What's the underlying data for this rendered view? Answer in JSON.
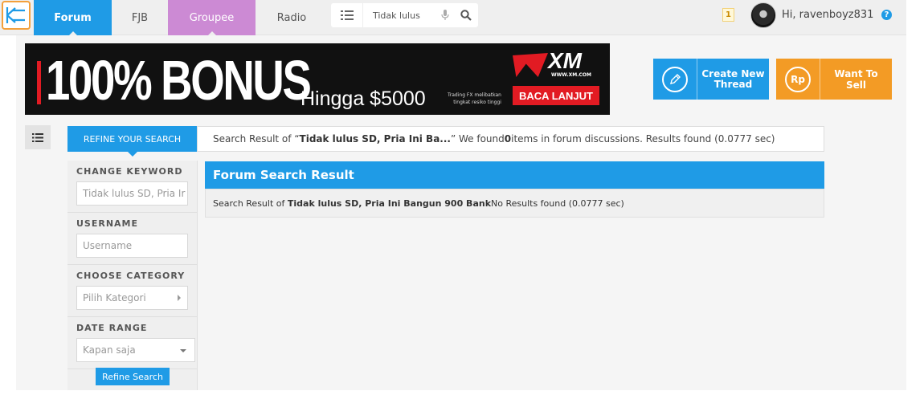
{
  "nav": {
    "logo_icon": "kaskus-logo-icon",
    "items": [
      {
        "label": "Forum"
      },
      {
        "label": "FJB"
      },
      {
        "label": "Groupee"
      },
      {
        "label": "Radio"
      }
    ],
    "search": {
      "value": "Tidak lulus"
    },
    "notification_count": "1",
    "greeting": "Hi, ravenboyz831",
    "help": "?"
  },
  "banner": {
    "headline": "100% BONUS",
    "subline": "Hingga $5000",
    "disclaimer_1": "Trading FX melibatkan",
    "disclaimer_2": "tingkat resiko tinggi",
    "brand": "XM",
    "brand_url": "WWW.XM.COM",
    "cta": "BACA LANJUT"
  },
  "actions": {
    "create_thread": "Create New Thread",
    "want_to_sell": "Want To Sell",
    "rp_symbol": "Rp"
  },
  "refine": {
    "tab_label": "REFINE YOUR SEARCH",
    "sections": {
      "keyword": {
        "title": "CHANGE KEYWORD",
        "value": "Tidak lulus SD, Pria Ir"
      },
      "username": {
        "title": "USERNAME",
        "placeholder": "Username"
      },
      "category": {
        "title": "CHOOSE CATEGORY",
        "value": "Pilih Kategori"
      },
      "date": {
        "title": "DATE RANGE",
        "value": "Kapan saja"
      }
    },
    "button": "Refine Search"
  },
  "result_bar": {
    "prefix": "Search Result of “",
    "query": "Tidak lulus SD, Pria Ini Ba...",
    "mid": "” We found ",
    "count": "0",
    "suffix": " items in forum discussions. Results found (0.0777 sec)"
  },
  "forum_result": {
    "title": "Forum Search Result",
    "prefix": "Search Result of ",
    "query": "Tidak lulus SD, Pria Ini Bangun 900 Bank",
    "suffix": " No Results found (0.0777 sec)"
  },
  "colors": {
    "primary": "#1f9be6",
    "groupee": "#cc8ad4",
    "sell": "#f39b25",
    "xm_red": "#e21b23"
  }
}
